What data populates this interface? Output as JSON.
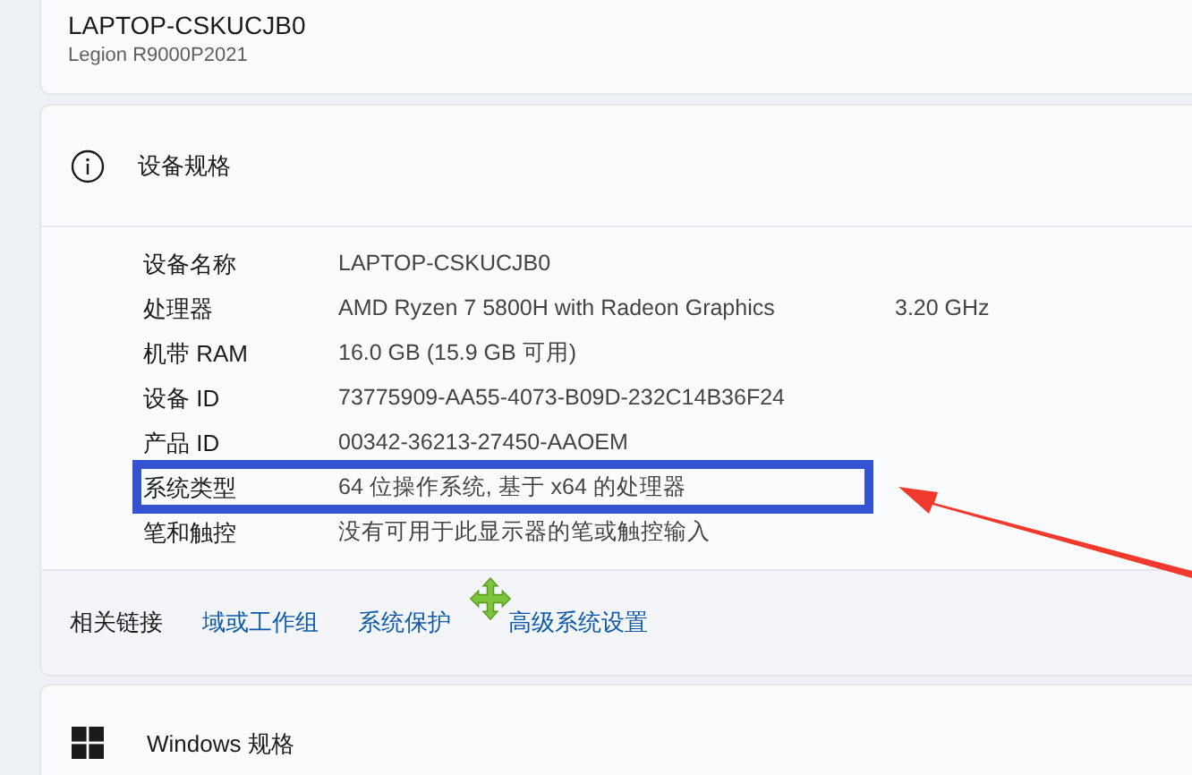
{
  "device": {
    "name": "LAPTOP-CSKUCJB0",
    "model": "Legion R9000P2021"
  },
  "specs": {
    "title": "设备规格",
    "rows": [
      {
        "label": "设备名称",
        "value": "LAPTOP-CSKUCJB0",
        "highlighted": false
      },
      {
        "label": "处理器",
        "value": "AMD Ryzen 7 5800H with Radeon Graphics",
        "extra": "3.20 GHz",
        "highlighted": false
      },
      {
        "label": "机带 RAM",
        "value": "16.0 GB (15.9 GB 可用)",
        "highlighted": false
      },
      {
        "label": "设备 ID",
        "value": "73775909-AA55-4073-B09D-232C14B36F24",
        "highlighted": false
      },
      {
        "label": "产品 ID",
        "value": "00342-36213-27450-AAOEM",
        "highlighted": false
      },
      {
        "label": "系统类型",
        "value": "64 位操作系统, 基于 x64 的处理器",
        "highlighted": true
      },
      {
        "label": "笔和触控",
        "value": "没有可用于此显示器的笔或触控输入",
        "highlighted": false
      }
    ]
  },
  "related_links": {
    "label": "相关链接",
    "links": [
      "域或工作组",
      "系统保护",
      "高级系统设置"
    ]
  },
  "windows_specs": {
    "title": "Windows 规格"
  }
}
